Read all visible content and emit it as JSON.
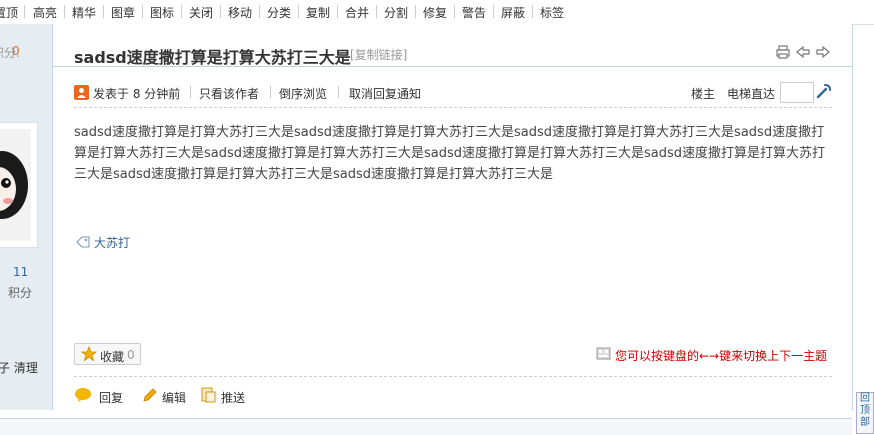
{
  "toolbar": {
    "items": [
      "置顶",
      "高亮",
      "精华",
      "图章",
      "图标",
      "关闭",
      "移动",
      "分类",
      "复制",
      "合并",
      "分割",
      "修复",
      "警告",
      "屏蔽",
      "标签"
    ]
  },
  "sidebar": {
    "top_label": "积分:",
    "top_value": "0",
    "stat_value": "11",
    "stat_label": "积分",
    "bottom_text": "子 清理"
  },
  "post": {
    "title": "sadsd速度撒打算是打算大苏打三大是",
    "copy_link": "[复制链接]",
    "posted": "发表于 8 分钟前",
    "only_author": "只看该作者",
    "reverse": "倒序浏览",
    "cancel_notify": "取消回复通知",
    "floor_label": "楼主",
    "elevator_label": "电梯直达",
    "elevator_value": "",
    "content": "sadsd速度撒打算是打算大苏打三大是sadsd速度撒打算是打算大苏打三大是sadsd速度撒打算是打算大苏打三大是sadsd速度撒打算是打算大苏打三大是sadsd速度撒打算是打算大苏打三大是sadsd速度撒打算是打算大苏打三大是sadsd速度撒打算是打算大苏打三大是sadsd速度撒打算是打算大苏打三大是sadsd速度撒打算是打算大苏打三大是",
    "tag": "大苏打",
    "favorite_label": "收藏",
    "favorite_count": "0",
    "keyboard_hint": "您可以按键盘的←→键来切换上下一主题",
    "reply": "回复",
    "edit": "编辑",
    "recommend": "推送"
  },
  "back_to_top": "回顶部",
  "colors": {
    "link": "#336699",
    "hint": "#cc0000",
    "sidebar_bg": "#e5edf2",
    "accent_orange": "#e8681f"
  }
}
